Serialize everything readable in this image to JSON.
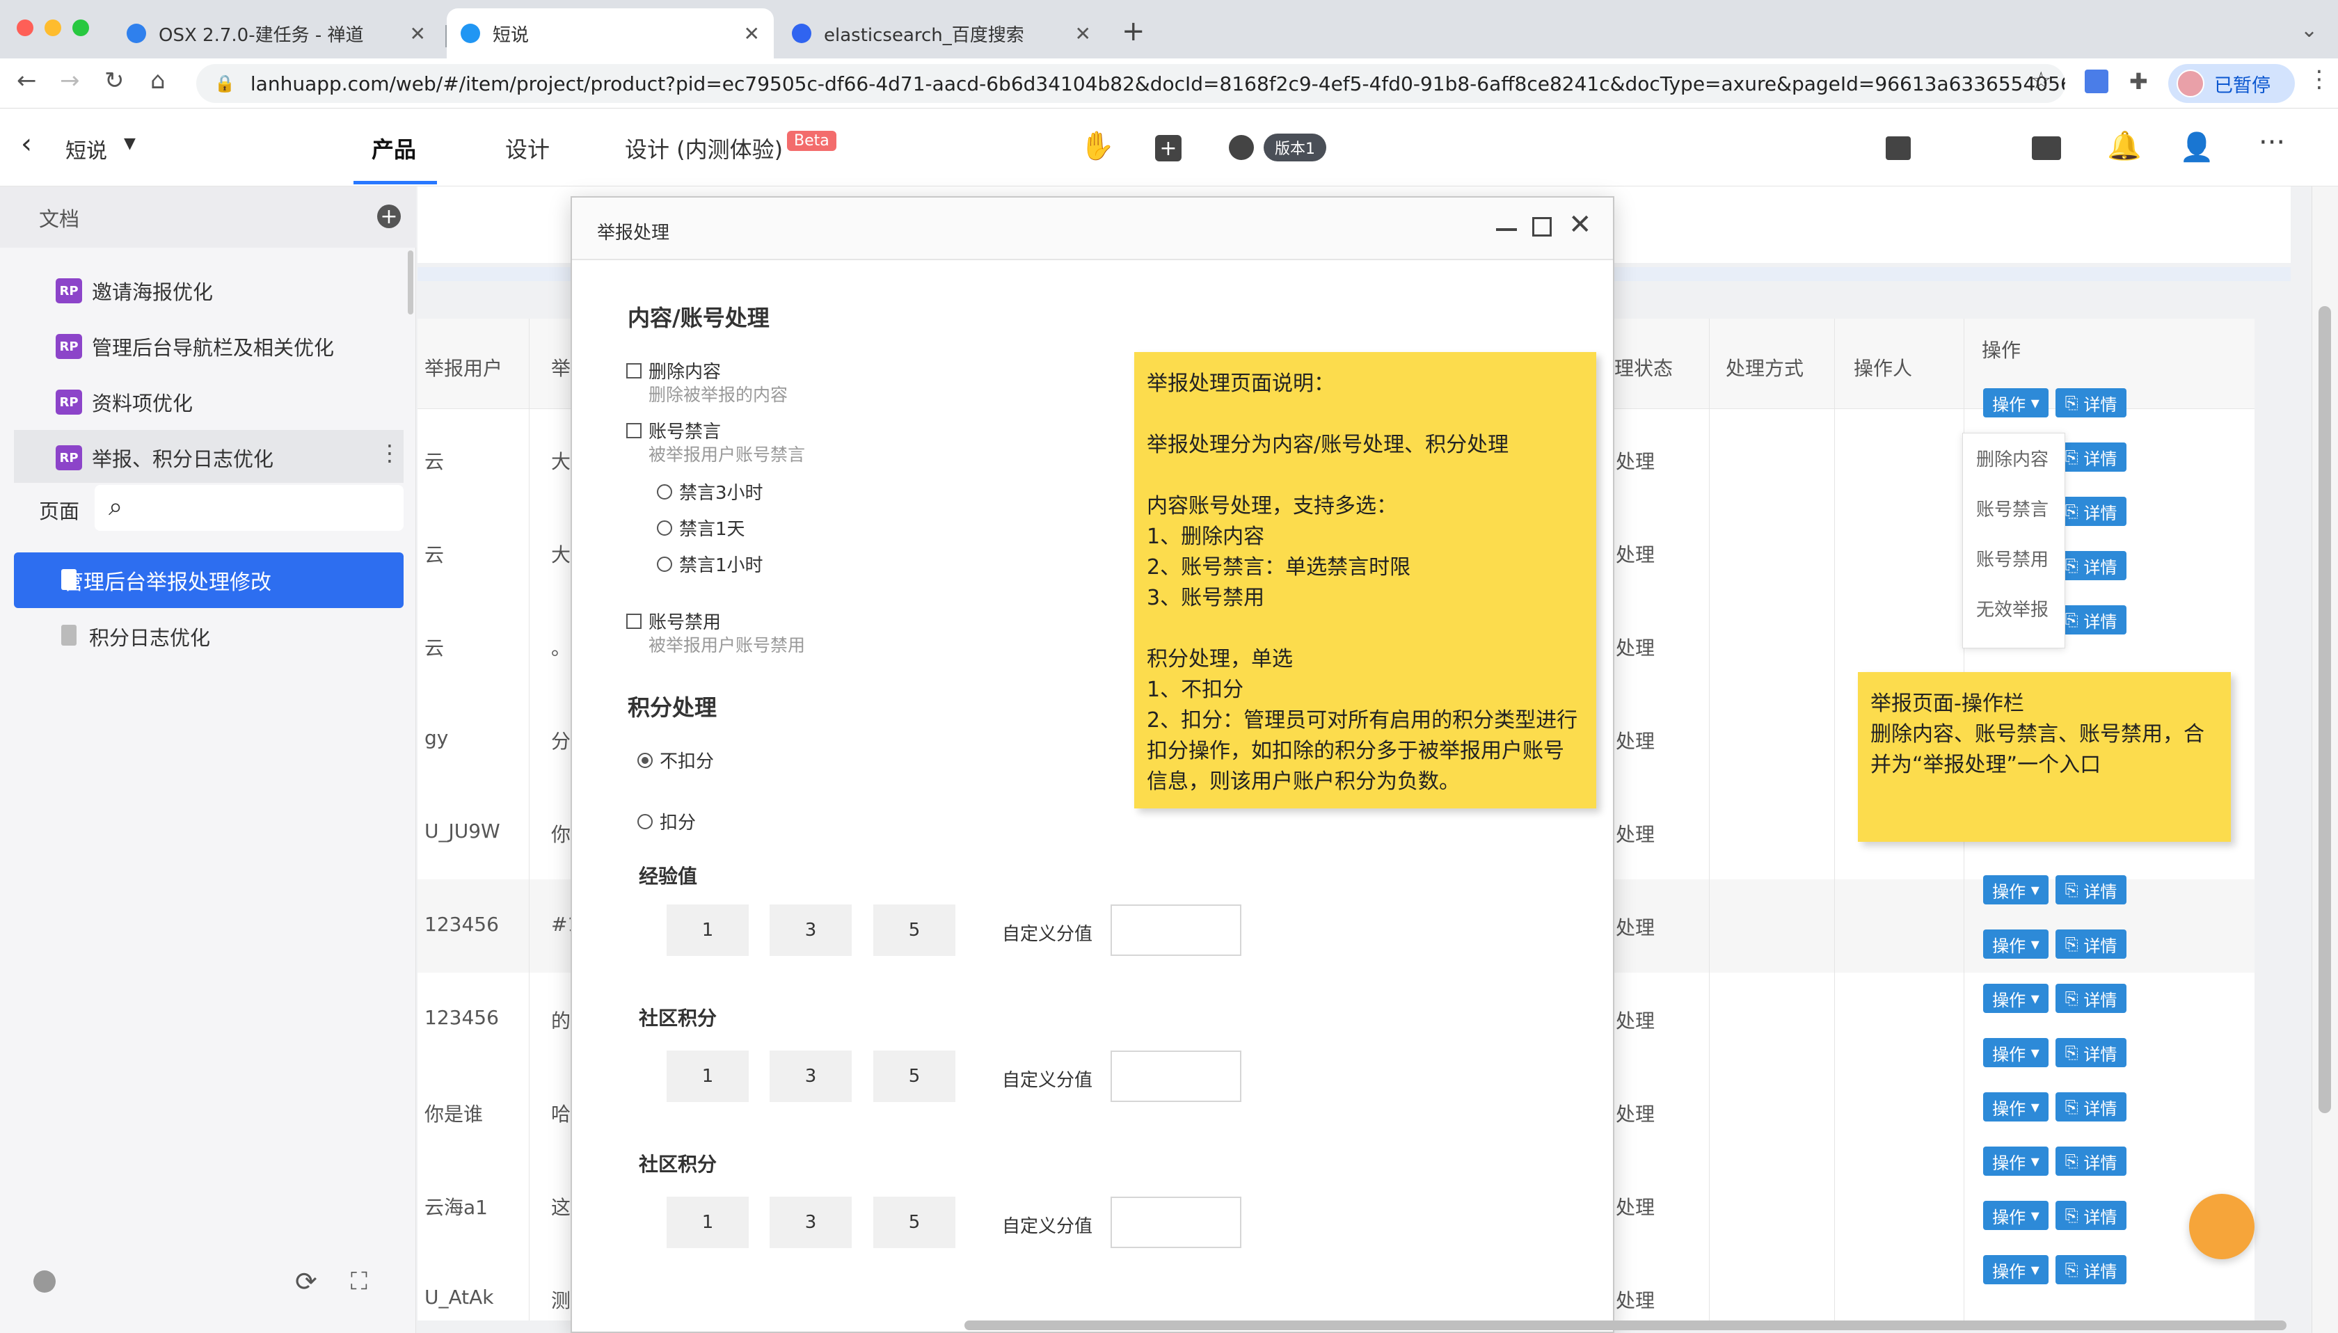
{
  "browser": {
    "tabs": [
      {
        "title": "OSX 2.7.0-建任务 - 禅道",
        "active": false,
        "favicon_color": "#2f80ed"
      },
      {
        "title": "短说",
        "active": true,
        "favicon_color": "#2196f3"
      },
      {
        "title": "elasticsearch_百度搜索",
        "active": false,
        "favicon_color": "#3064f0"
      }
    ],
    "url": "lanhuapp.com/web/#/item/project/product?pid=ec79505c-df66-4d71-aacd-6b6d34104b82&docId=8168f2c9-4ef5-4fd0-91b8-6aff8ce8241c&docType=axure&pageId=96613a6336554056...",
    "profile_label": "已暂停"
  },
  "app": {
    "project_name": "短说",
    "nav_tabs": [
      "产品",
      "设计",
      "设计 (内测体验)"
    ],
    "beta_label": "Beta",
    "version_label": "版本1"
  },
  "sidebar": {
    "docs_header": "文档",
    "docs": [
      {
        "badge": "RP",
        "label": "邀请海报优化"
      },
      {
        "badge": "RP",
        "label": "管理后台导航栏及相关优化"
      },
      {
        "badge": "RP",
        "label": "资料项优化"
      },
      {
        "badge": "RP",
        "label": "举报、积分日志优化"
      }
    ],
    "pages_label": "页面",
    "search_placeholder": "",
    "pages": [
      {
        "label": "管理后台举报处理修改",
        "selected": true
      },
      {
        "label": "积分日志优化",
        "selected": false
      }
    ]
  },
  "table": {
    "left_headers": [
      "举报用户",
      "举"
    ],
    "right_headers": [
      "理状态",
      "处理方式",
      "操作人",
      "操作"
    ],
    "rows": [
      {
        "user": "云",
        "c2": "大",
        "status": "处理"
      },
      {
        "user": "云",
        "c2": "大",
        "status": "处理"
      },
      {
        "user": "云",
        "c2": "。",
        "status": "处理"
      },
      {
        "user": "gy",
        "c2": "分",
        "status": "处理"
      },
      {
        "user": "U_JU9W",
        "c2": "你",
        "status": "处理"
      },
      {
        "user": "123456",
        "c2": "#1",
        "status": "处理"
      },
      {
        "user": "123456",
        "c2": "的",
        "status": "处理"
      },
      {
        "user": "你是谁",
        "c2": "哈",
        "status": "处理"
      },
      {
        "user": "云海a1",
        "c2": "这",
        "status": "处理"
      },
      {
        "user": "U_AtAk",
        "c2": "测",
        "status": "处理"
      }
    ],
    "op_button_label": "操作",
    "detail_button_label": "详情",
    "dropdown_items": [
      "删除内容",
      "账号禁言",
      "账号禁用",
      "无效举报"
    ]
  },
  "dialog": {
    "title": "举报处理",
    "section1_title": "内容/账号处理",
    "delete_content": {
      "label": "删除内容",
      "hint": "删除被举报的内容"
    },
    "mute": {
      "label": "账号禁言",
      "hint": "被举报用户账号禁言"
    },
    "mute_options": [
      "禁言3小时",
      "禁言1天",
      "禁言1小时"
    ],
    "ban": {
      "label": "账号禁用",
      "hint": "被举报用户账号禁用"
    },
    "section2_title": "积分处理",
    "no_deduct": "不扣分",
    "deduct": "扣分",
    "groups": [
      {
        "title": "经验值",
        "values": [
          "1",
          "3",
          "5"
        ],
        "custom_label": "自定义分值"
      },
      {
        "title": "社区积分",
        "values": [
          "1",
          "3",
          "5"
        ],
        "custom_label": "自定义分值"
      },
      {
        "title": "社区积分",
        "values": [
          "1",
          "3",
          "5"
        ],
        "custom_label": "自定义分值"
      }
    ]
  },
  "notes": {
    "main": "举报处理页面说明：\n\n举报处理分为内容/账号处理、积分处理\n\n内容账号处理，支持多选：\n1、删除内容\n2、账号禁言：单选禁言时限\n3、账号禁用\n\n积分处理，单选\n1、不扣分\n2、扣分：管理员可对所有启用的积分类型进行扣分操作，如扣除的积分多于被举报用户账号信息，则该用户账户积分为负数。",
    "side": "举报页面-操作栏\n删除内容、账号禁言、账号禁用，合并为“举报处理”一个入口"
  },
  "colors": {
    "primary": "#2d6ef0",
    "note": "#fcdc4d",
    "op_button": "#2d8ad8",
    "beta": "#f36c6c"
  }
}
